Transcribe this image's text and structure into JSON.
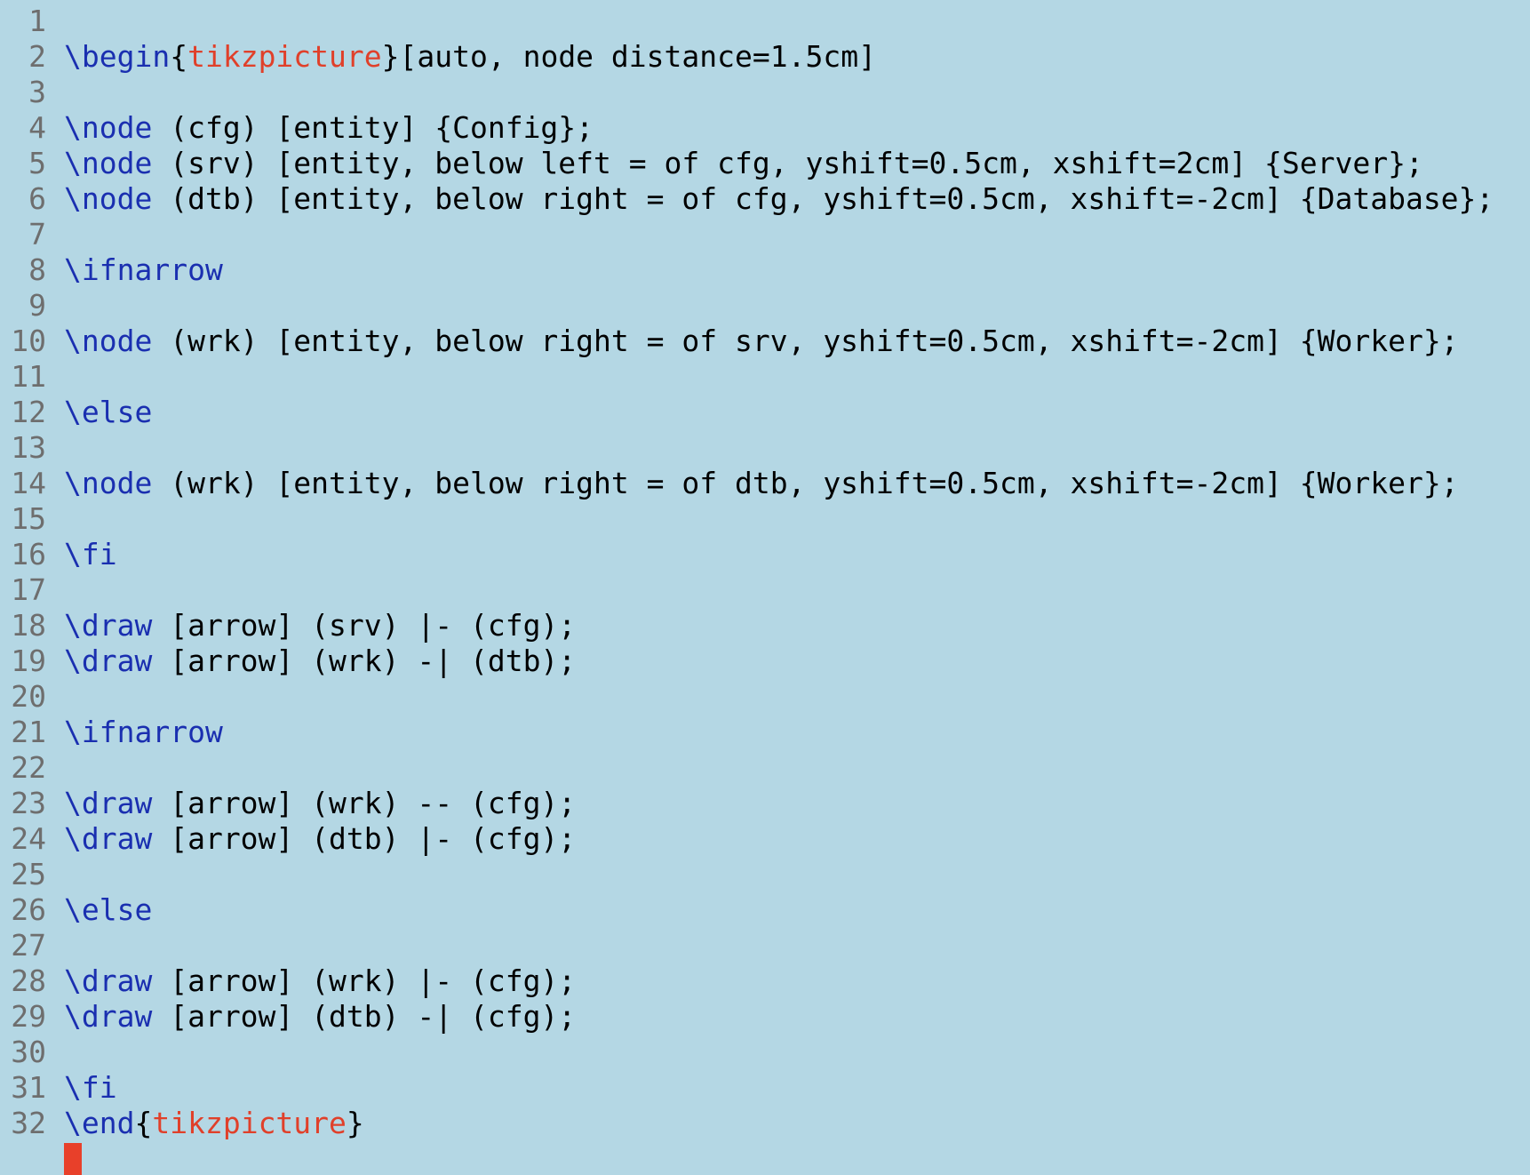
{
  "editor": {
    "background": "#b4d7e4",
    "colors": {
      "command": "#1a2fb0",
      "environment": "#e0402a",
      "text": "#000000",
      "line_number": "#6e6e6e",
      "cursor": "#e8402a"
    },
    "lines": [
      {
        "n": "1",
        "tokens": []
      },
      {
        "n": "2",
        "tokens": [
          {
            "t": "cmd",
            "s": "\\begin"
          },
          {
            "t": "plain",
            "s": "{"
          },
          {
            "t": "env",
            "s": "tikzpicture"
          },
          {
            "t": "plain",
            "s": "}[auto, node distance=1.5cm]"
          }
        ]
      },
      {
        "n": "3",
        "tokens": []
      },
      {
        "n": "4",
        "tokens": [
          {
            "t": "cmd",
            "s": "\\node"
          },
          {
            "t": "plain",
            "s": " (cfg) [entity] {Config};"
          }
        ]
      },
      {
        "n": "5",
        "tokens": [
          {
            "t": "cmd",
            "s": "\\node"
          },
          {
            "t": "plain",
            "s": " (srv) [entity, below left = of cfg, yshift=0.5cm, xshift=2cm] {Server};"
          }
        ]
      },
      {
        "n": "6",
        "tokens": [
          {
            "t": "cmd",
            "s": "\\node"
          },
          {
            "t": "plain",
            "s": " (dtb) [entity, below right = of cfg, yshift=0.5cm, xshift=-2cm] {Database};"
          }
        ]
      },
      {
        "n": "7",
        "tokens": []
      },
      {
        "n": "8",
        "tokens": [
          {
            "t": "cmd",
            "s": "\\ifnarrow"
          }
        ]
      },
      {
        "n": "9",
        "tokens": []
      },
      {
        "n": "10",
        "tokens": [
          {
            "t": "cmd",
            "s": "\\node"
          },
          {
            "t": "plain",
            "s": " (wrk) [entity, below right = of srv, yshift=0.5cm, xshift=-2cm] {Worker};"
          }
        ]
      },
      {
        "n": "11",
        "tokens": []
      },
      {
        "n": "12",
        "tokens": [
          {
            "t": "cmd",
            "s": "\\else"
          }
        ]
      },
      {
        "n": "13",
        "tokens": []
      },
      {
        "n": "14",
        "tokens": [
          {
            "t": "cmd",
            "s": "\\node"
          },
          {
            "t": "plain",
            "s": " (wrk) [entity, below right = of dtb, yshift=0.5cm, xshift=-2cm] {Worker};"
          }
        ]
      },
      {
        "n": "15",
        "tokens": []
      },
      {
        "n": "16",
        "tokens": [
          {
            "t": "cmd",
            "s": "\\fi"
          }
        ]
      },
      {
        "n": "17",
        "tokens": []
      },
      {
        "n": "18",
        "tokens": [
          {
            "t": "cmd",
            "s": "\\draw"
          },
          {
            "t": "plain",
            "s": " [arrow] (srv) |- (cfg);"
          }
        ]
      },
      {
        "n": "19",
        "tokens": [
          {
            "t": "cmd",
            "s": "\\draw"
          },
          {
            "t": "plain",
            "s": " [arrow] (wrk) -| (dtb);"
          }
        ]
      },
      {
        "n": "20",
        "tokens": []
      },
      {
        "n": "21",
        "tokens": [
          {
            "t": "cmd",
            "s": "\\ifnarrow"
          }
        ]
      },
      {
        "n": "22",
        "tokens": []
      },
      {
        "n": "23",
        "tokens": [
          {
            "t": "cmd",
            "s": "\\draw"
          },
          {
            "t": "plain",
            "s": " [arrow] (wrk) -- (cfg);"
          }
        ]
      },
      {
        "n": "24",
        "tokens": [
          {
            "t": "cmd",
            "s": "\\draw"
          },
          {
            "t": "plain",
            "s": " [arrow] (dtb) |- (cfg);"
          }
        ]
      },
      {
        "n": "25",
        "tokens": []
      },
      {
        "n": "26",
        "tokens": [
          {
            "t": "cmd",
            "s": "\\else"
          }
        ]
      },
      {
        "n": "27",
        "tokens": []
      },
      {
        "n": "28",
        "tokens": [
          {
            "t": "cmd",
            "s": "\\draw"
          },
          {
            "t": "plain",
            "s": " [arrow] (wrk) |- (cfg);"
          }
        ]
      },
      {
        "n": "29",
        "tokens": [
          {
            "t": "cmd",
            "s": "\\draw"
          },
          {
            "t": "plain",
            "s": " [arrow] (dtb) -| (cfg);"
          }
        ]
      },
      {
        "n": "30",
        "tokens": []
      },
      {
        "n": "31",
        "tokens": [
          {
            "t": "cmd",
            "s": "\\fi"
          }
        ]
      },
      {
        "n": "32",
        "tokens": [
          {
            "t": "cmd",
            "s": "\\end"
          },
          {
            "t": "plain",
            "s": "{"
          },
          {
            "t": "env",
            "s": "tikzpicture"
          },
          {
            "t": "plain",
            "s": "}"
          }
        ]
      }
    ]
  }
}
